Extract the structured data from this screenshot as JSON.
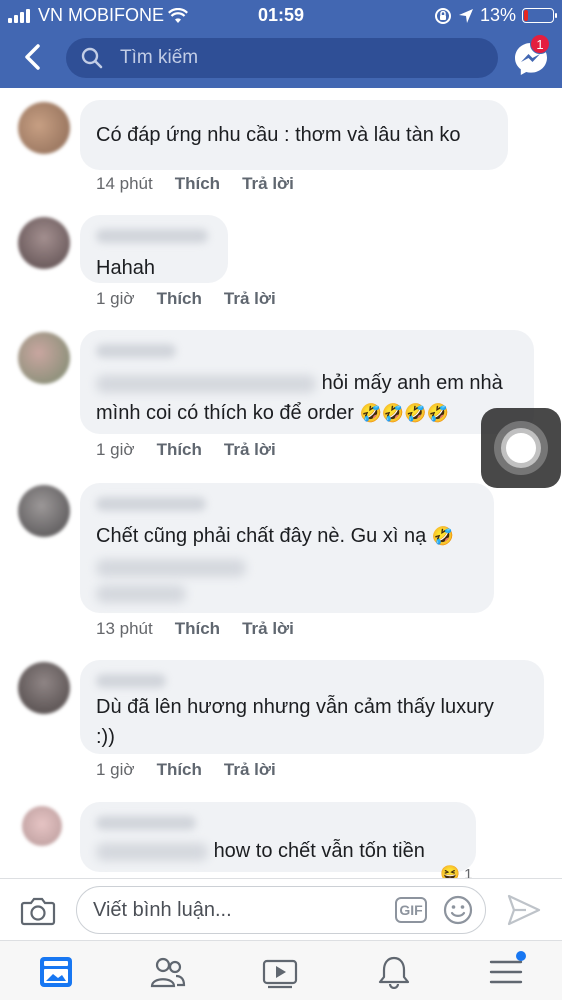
{
  "status_bar": {
    "carrier": "VN MOBIFONE",
    "time": "01:59",
    "battery": "13%",
    "battery_level": 0.13
  },
  "nav": {
    "search_placeholder": "Tìm kiếm",
    "messenger_badge": "1"
  },
  "comments": [
    {
      "text": "Có đáp ứng nhu cầu : thơm và lâu tàn ko",
      "time": "14 phút",
      "like": "Thích",
      "reply": "Trả lời"
    },
    {
      "text": "Hahah",
      "time": "1 giờ",
      "like": "Thích",
      "reply": "Trả lời"
    },
    {
      "text_line1": "hỏi mấy anh em nhà",
      "text_line2": "mình coi có thích ko để order",
      "emojis": "🤣🤣🤣🤣",
      "time": "1 giờ",
      "like": "Thích",
      "reply": "Trả lời"
    },
    {
      "text": "Chết cũng phải chất đây nè. Gu xì nạ",
      "emoji": "🤣",
      "time": "13 phút",
      "like": "Thích",
      "reply": "Trả lời"
    },
    {
      "text_line1": "Dù đã lên hương nhưng vẫn cảm thấy luxury",
      "text_line2": ":))",
      "time": "1 giờ",
      "like": "Thích",
      "reply": "Trả lời"
    },
    {
      "text": "how to chết vẫn tốn tiền",
      "reaction_count": "1"
    }
  ],
  "composer": {
    "placeholder": "Viết bình luận...",
    "gif_label": "GIF"
  },
  "icons": {
    "back": "chevron-left-icon",
    "search": "search-icon",
    "messenger": "messenger-icon",
    "camera": "camera-icon",
    "emoji": "smiley-icon",
    "send": "send-icon",
    "tabs": [
      "news-feed-icon",
      "friends-icon",
      "watch-icon",
      "notifications-icon",
      "menu-icon"
    ]
  },
  "colors": {
    "brand": "#4267b2",
    "search_bg": "#2f4f96",
    "bubble": "#f0f2f5",
    "badge": "#e41e3f",
    "active_tab": "#1877f2"
  }
}
